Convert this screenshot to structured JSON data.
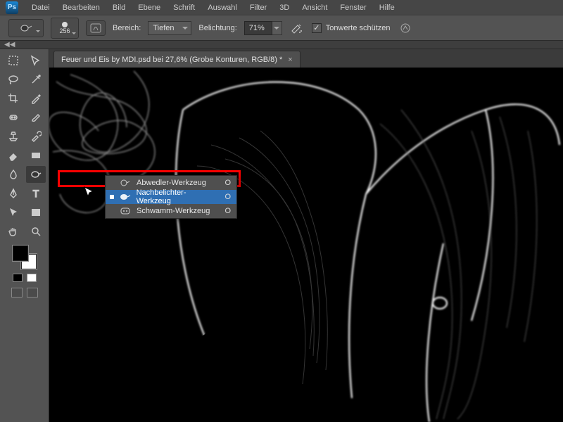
{
  "menu": {
    "items": [
      "Datei",
      "Bearbeiten",
      "Bild",
      "Ebene",
      "Schrift",
      "Auswahl",
      "Filter",
      "3D",
      "Ansicht",
      "Fenster",
      "Hilfe"
    ]
  },
  "options": {
    "brush_size": "256",
    "range_label": "Bereich:",
    "range_value": "Tiefen",
    "exposure_label": "Belichtung:",
    "exposure_value": "71%",
    "protect_label": "Tonwerte schützen"
  },
  "document": {
    "tab_title": "Feuer und Eis by MDI.psd bei 27,6% (Grobe Konturen, RGB/8) *"
  },
  "flyout": {
    "items": [
      {
        "label": "Abwedler-Werkzeug",
        "shortcut": "O",
        "selected": false
      },
      {
        "label": "Nachbelichter-Werkzeug",
        "shortcut": "O",
        "selected": true
      },
      {
        "label": "Schwamm-Werkzeug",
        "shortcut": "O",
        "selected": false
      }
    ]
  }
}
